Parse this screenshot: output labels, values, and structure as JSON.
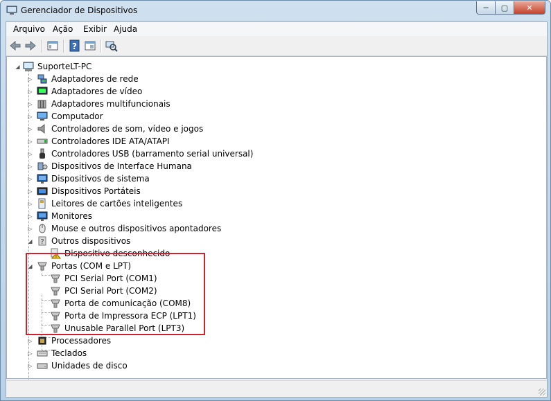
{
  "window": {
    "title": "Gerenciador de Dispositivos"
  },
  "menu": [
    {
      "label": "Arquivo"
    },
    {
      "label": "Ação"
    },
    {
      "label": "Exibir"
    },
    {
      "label": "Ajuda"
    }
  ],
  "tree": {
    "root": "SuporteLT-PC",
    "categories": [
      {
        "label": "Adaptadores de rede",
        "icon": "network-adapter-icon"
      },
      {
        "label": "Adaptadores de vídeo",
        "icon": "display-adapter-icon"
      },
      {
        "label": "Adaptadores multifuncionais",
        "icon": "multifunction-adapter-icon"
      },
      {
        "label": "Computador",
        "icon": "computer-icon"
      },
      {
        "label": "Controladores de som, vídeo e jogos",
        "icon": "speaker-icon"
      },
      {
        "label": "Controladores IDE ATA/ATAPI",
        "icon": "ide-controller-icon"
      },
      {
        "label": "Controladores USB (barramento serial universal)",
        "icon": "usb-icon"
      },
      {
        "label": "Dispositivos de Interface Humana",
        "icon": "hid-icon"
      },
      {
        "label": "Dispositivos de sistema",
        "icon": "system-device-icon"
      },
      {
        "label": "Dispositivos Portáteis",
        "icon": "portable-device-icon"
      },
      {
        "label": "Leitores de cartões inteligentes",
        "icon": "smart-card-reader-icon"
      },
      {
        "label": "Monitores",
        "icon": "monitor-icon"
      },
      {
        "label": "Mouse e outros dispositivos apontadores",
        "icon": "mouse-icon"
      }
    ],
    "other_devices": {
      "label": "Outros dispositivos",
      "children": [
        {
          "label": "Dispositivo desconhecido"
        }
      ]
    },
    "ports": {
      "label": "Portas (COM e LPT)",
      "children": [
        {
          "label": "PCI Serial Port (COM1)"
        },
        {
          "label": "PCI Serial Port (COM2)"
        },
        {
          "label": "Porta de comunicação (COM8)"
        },
        {
          "label": "Porta de Impressora ECP (LPT1)"
        },
        {
          "label": "Unusable Parallel Port (LPT3)"
        }
      ]
    },
    "after": [
      {
        "label": "Processadores",
        "icon": "processor-icon"
      },
      {
        "label": "Teclados",
        "icon": "keyboard-icon"
      },
      {
        "label": "Unidades de disco",
        "icon": "disk-drive-icon"
      }
    ]
  },
  "colors": {
    "highlight_border": "#d2202f"
  }
}
